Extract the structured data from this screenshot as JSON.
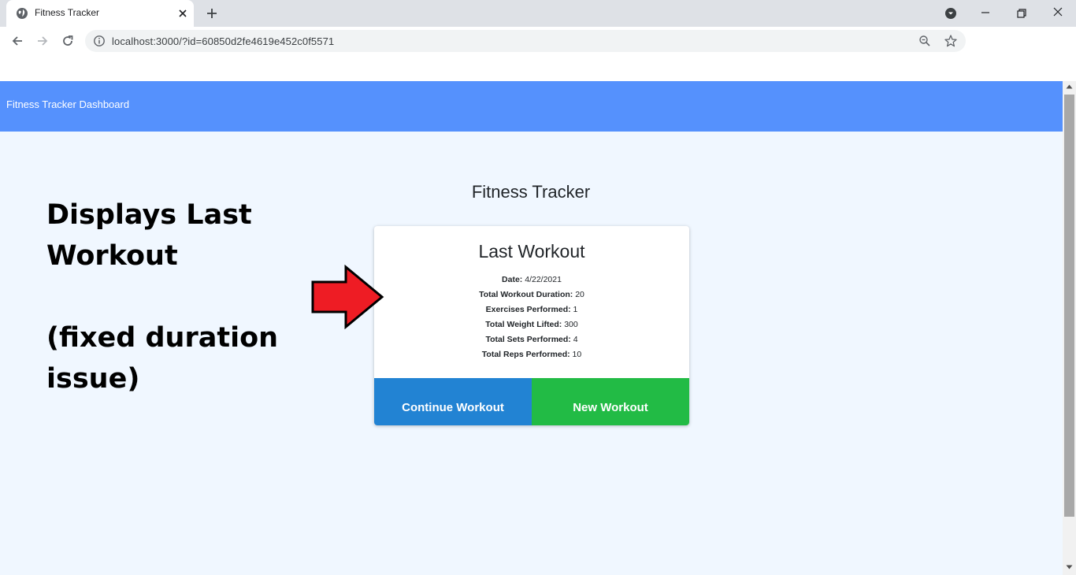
{
  "browser": {
    "tab_title": "Fitness Tracker",
    "url": "localhost:3000/?id=60850d2fe4619e452c0f5571",
    "icons": {
      "favicon": "globe-icon",
      "tab_close": "close-icon",
      "new_tab": "plus-icon",
      "profile": "profile-dropdown-icon",
      "minimize": "minimize-icon",
      "restore": "restore-icon",
      "close_window": "close-icon",
      "back": "back-arrow-icon",
      "forward": "forward-arrow-icon",
      "reload": "reload-icon",
      "info": "info-icon",
      "zoom": "zoom-out-icon",
      "bookmark": "star-icon"
    }
  },
  "navbar": {
    "brand": "Fitness Tracker Dashboard",
    "color": "#5591fd"
  },
  "main": {
    "heading": "Fitness Tracker",
    "card": {
      "title": "Last Workout",
      "stats": [
        {
          "label": "Date:",
          "value": "4/22/2021"
        },
        {
          "label": "Total Workout Duration:",
          "value": "20"
        },
        {
          "label": "Exercises Performed:",
          "value": "1"
        },
        {
          "label": "Total Weight Lifted:",
          "value": "300"
        },
        {
          "label": "Total Sets Performed:",
          "value": "4"
        },
        {
          "label": "Total Reps Performed:",
          "value": "10"
        }
      ]
    },
    "buttons": {
      "continue": {
        "label": "Continue Workout",
        "color": "#2283d3"
      },
      "new": {
        "label": "New Workout",
        "color": "#22bb45"
      }
    }
  },
  "annotation": {
    "line1": "Displays Last",
    "line2": "Workout",
    "line3": "(fixed duration",
    "line4": "issue)",
    "arrow_color": "#ee1c24",
    "arrow_icon": "right-arrow-icon"
  },
  "colors": {
    "page_background": "#f0f7ff",
    "card_background": "#ffffff"
  }
}
